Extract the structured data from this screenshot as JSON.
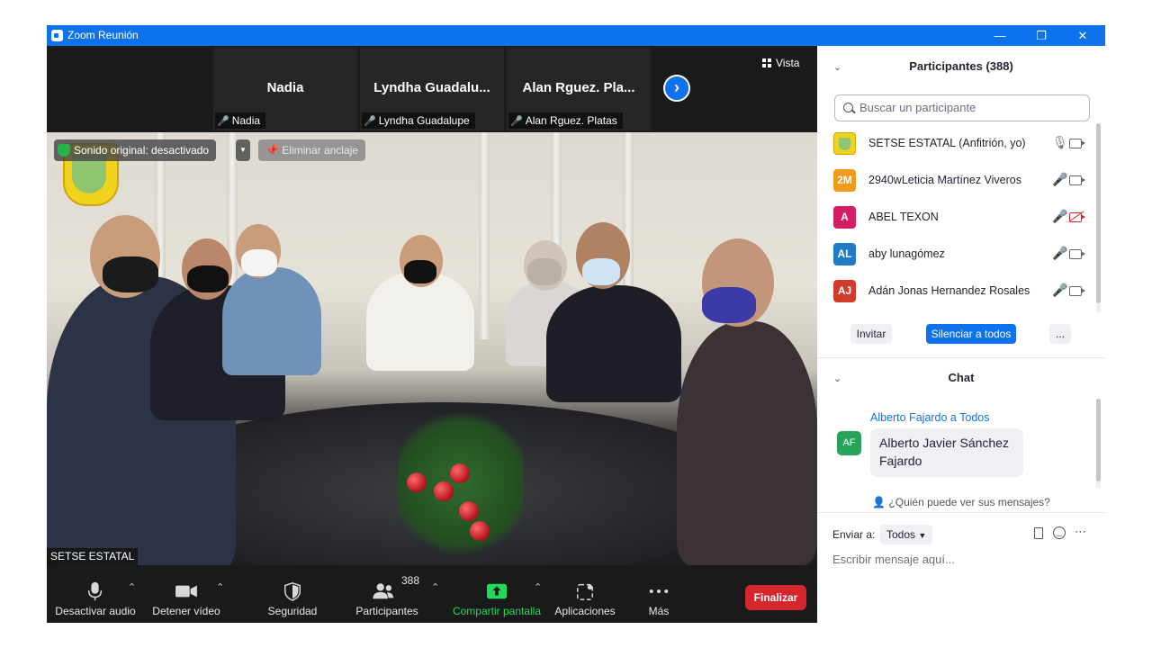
{
  "window": {
    "title": "Zoom Reunión",
    "minimize": "—",
    "restore": "❐",
    "close": "✕",
    "brand_color": "#0e72ed"
  },
  "strip": {
    "tiles": [
      {
        "display_name": "Nadia",
        "label": "Nadia"
      },
      {
        "display_name": "Lyndha  Guadalu...",
        "label": "Lyndha Guadalupe"
      },
      {
        "display_name": "Alan  Rguez. Pla...",
        "label": "Alan  Rguez. Platas"
      }
    ],
    "next_icon": "›",
    "view_label": "Vista"
  },
  "video": {
    "original_sound": "Sonido original: desactivado",
    "unpin_label": "Eliminar anclaje",
    "speaker_name": "SETSE ESTATAL"
  },
  "toolbar": {
    "mute_label": "Desactivar audio",
    "video_label": "Detener vídeo",
    "security_label": "Seguridad",
    "participants_label": "Participantes",
    "participants_count": "388",
    "share_label": "Compartir pantalla",
    "apps_label": "Aplicaciones",
    "more_label": "Más",
    "end_label": "Finalizar",
    "share_color": "#23d959",
    "end_color": "#d7252d"
  },
  "participants": {
    "title": "Participantes (388)",
    "search_placeholder": "Buscar un participante",
    "list": [
      {
        "name": "SETSE ESTATAL (Anfitrión, yo)",
        "initials": "",
        "color": "#f1d21c",
        "mic": "on",
        "cam": "on"
      },
      {
        "name": "2940wLeticia Martínez Viveros",
        "initials": "2M",
        "color": "#f29a1c",
        "mic": "muted",
        "cam": "on"
      },
      {
        "name": "ABEL TEXON",
        "initials": "A",
        "color": "#d41e63",
        "mic": "muted",
        "cam": "off"
      },
      {
        "name": "aby lunagómez",
        "initials": "AL",
        "color": "#1f7bc9",
        "mic": "muted",
        "cam": "on"
      },
      {
        "name": "Adán Jonas Hernandez Rosales",
        "initials": "AJ",
        "color": "#d23a2b",
        "mic": "muted",
        "cam": "on"
      }
    ],
    "invite_label": "Invitar",
    "mute_all_label": "Silenciar a todos",
    "more_label": "..."
  },
  "chat": {
    "title": "Chat",
    "messages": [
      {
        "from": "Alberto Fajardo a Todos",
        "initials": "AF",
        "text": "Alberto Javier Sánchez Fajardo"
      }
    ],
    "who_can_see": "¿Quién puede ver sus mensajes?",
    "send_to_label": "Enviar a:",
    "send_to_value": "Todos",
    "composer_placeholder": "Escribir mensaje aquí..."
  }
}
